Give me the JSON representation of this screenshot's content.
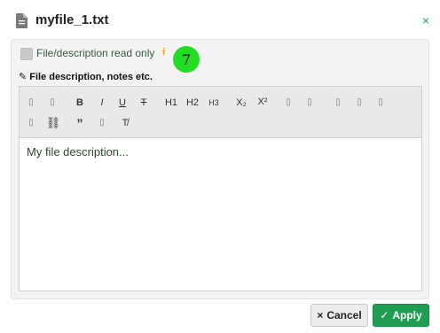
{
  "header": {
    "title": "myfile_1.txt",
    "file_icon": "document-icon",
    "close_icon": "close-icon",
    "close_glyph": "×"
  },
  "readonly": {
    "label": "File/description read only",
    "checked": false,
    "info_glyph": "i"
  },
  "step_badge": "7",
  "description": {
    "label": "File description, notes etc.",
    "pencil_glyph": "✎"
  },
  "toolbar": {
    "row1": [
      "▯",
      "▯",
      "B",
      "I",
      "U",
      "T",
      "H1",
      "H2",
      "H3",
      "X₂",
      "X²",
      "▯",
      "▯",
      "▯",
      "▯",
      "▯"
    ],
    "row2": [
      "▯",
      "⛓",
      "”",
      "▯",
      "T̸"
    ]
  },
  "editor_content": "My file description...",
  "footer": {
    "cancel_label": "Cancel",
    "cancel_glyph": "×",
    "apply_label": "Apply",
    "apply_glyph": "✓"
  },
  "colors": {
    "accent": "#1f9d52",
    "badge": "#22dd22",
    "info": "#f0a500"
  }
}
